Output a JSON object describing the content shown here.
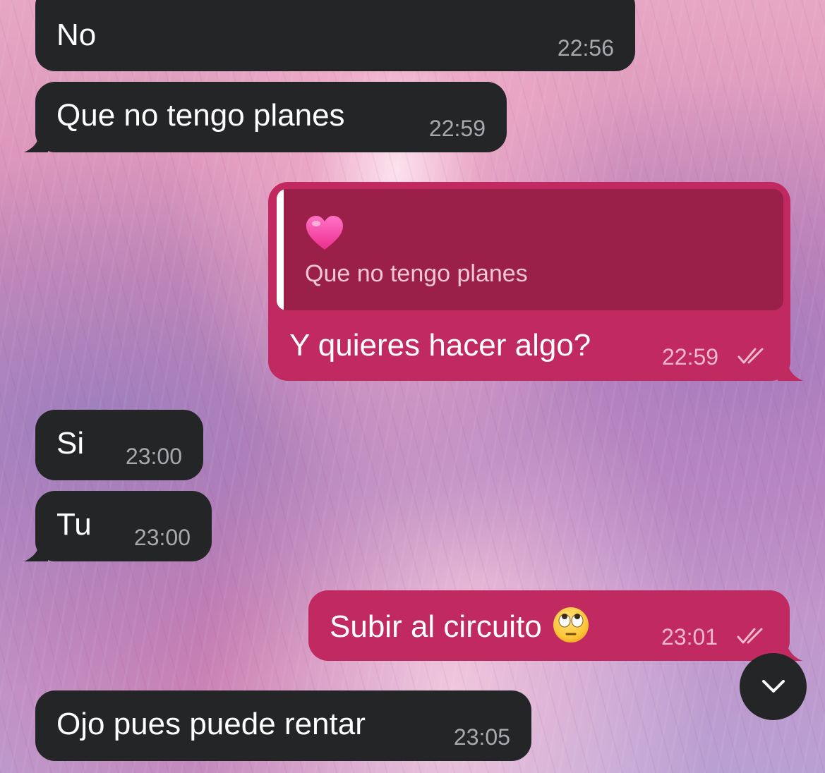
{
  "chat": {
    "messages": [
      {
        "type": "incoming",
        "text": "No",
        "time": "22:56"
      },
      {
        "type": "incoming",
        "text": "Que no tengo planes",
        "time": "22:59"
      },
      {
        "type": "outgoing",
        "reply_to": {
          "icon": "pink-heart-emoji",
          "text": "Que no tengo planes"
        },
        "text": "Y quieres hacer algo?",
        "time": "22:59",
        "status": "read"
      },
      {
        "type": "incoming",
        "text": "Si",
        "time": "23:00"
      },
      {
        "type": "incoming",
        "text": "Tu",
        "time": "23:00"
      },
      {
        "type": "outgoing",
        "text": "Subir al circuito",
        "emoji": "face-with-rolling-eyes-emoji",
        "time": "23:01",
        "status": "read"
      },
      {
        "type": "incoming",
        "text": "Ojo pues puede rentar",
        "time": "23:05"
      }
    ],
    "scroll_button": {
      "icon": "chevron-down-icon"
    }
  },
  "colors": {
    "incoming_bubble": "#242526",
    "outgoing_bubble": "#c02a60",
    "reply_block": "#9b2049"
  }
}
